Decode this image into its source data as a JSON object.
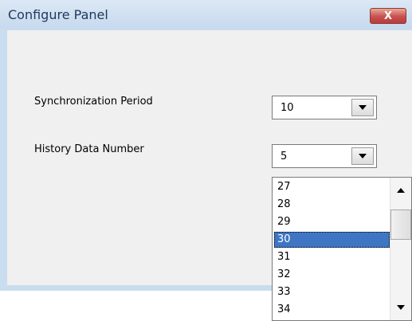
{
  "window": {
    "title": "Configure Panel",
    "close_label": "X"
  },
  "form": {
    "sync_label": "Synchronization Period",
    "sync_value": "10",
    "history_label": "History Data Number",
    "history_value": "5"
  },
  "dropdown": {
    "options": [
      "27",
      "28",
      "29",
      "30",
      "31",
      "32",
      "33",
      "34"
    ],
    "selected": "30"
  },
  "colors": {
    "selection": "#3f76c4",
    "titlebar": "#c6d9ee",
    "close_button": "#c75050"
  },
  "icons": [
    "close-icon",
    "chevron-down-icon",
    "scroll-up-icon",
    "scroll-down-icon"
  ]
}
